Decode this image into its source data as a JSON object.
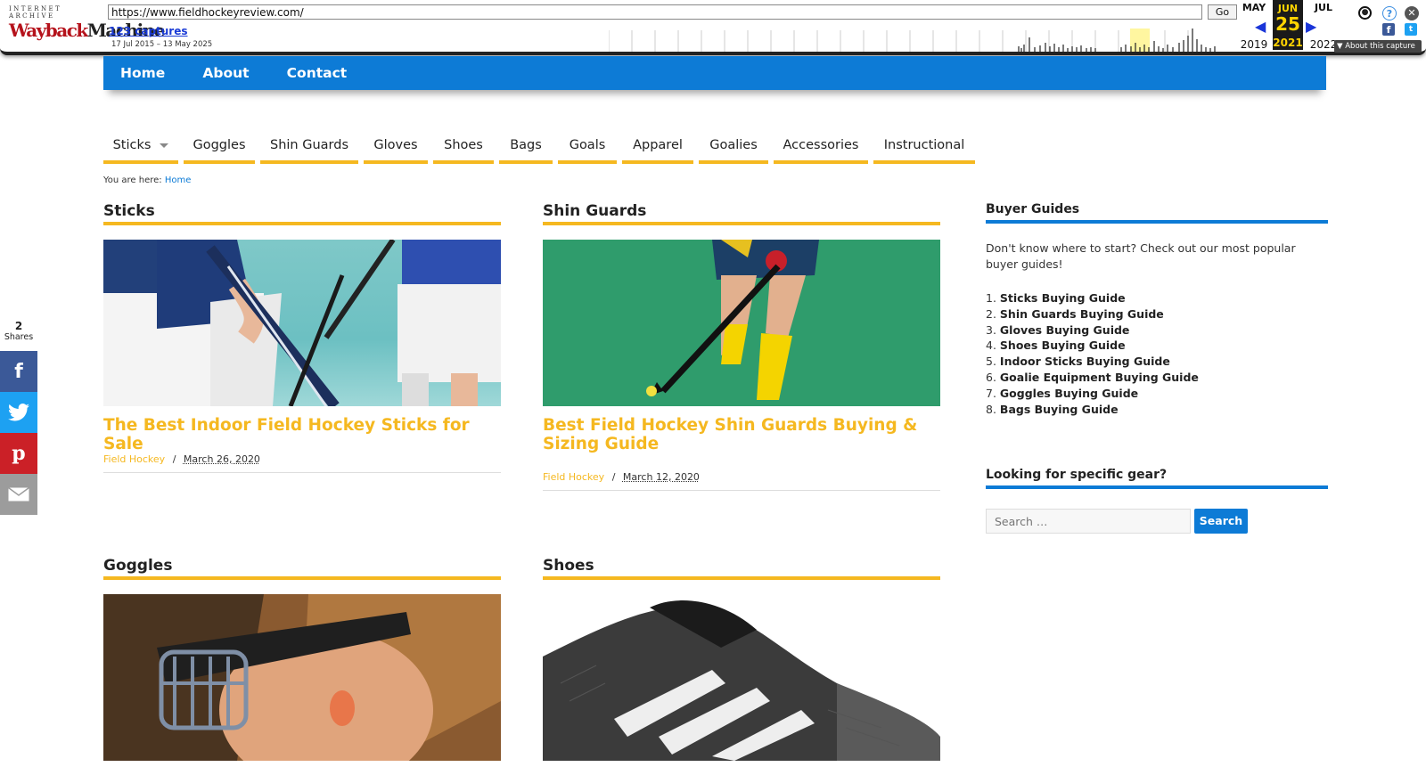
{
  "wayback": {
    "logo_top": "INTERNET ARCHIVE",
    "logo_wayback": "Wayback",
    "logo_machine": "Machine",
    "url": "https://www.fieldhockeyreview.com/",
    "go_label": "Go",
    "captures": "123 captures",
    "range": "17 Jul 2015 – 13 May 2025",
    "prev_month": "MAY",
    "cur_month": "JUN",
    "next_month": "JUL",
    "cur_day": "25",
    "prev_year": "2019",
    "cur_year": "2021",
    "next_year": "2022",
    "about": "▼ About this capture"
  },
  "topnav": [
    "Home",
    "About",
    "Contact"
  ],
  "catnav": {
    "items": [
      "Sticks",
      "Goggles",
      "Shin Guards",
      "Gloves",
      "Shoes",
      "Bags",
      "Goals",
      "Apparel",
      "Goalies",
      "Accessories",
      "Instructional"
    ]
  },
  "breadcrumb": {
    "prefix": "You are here: ",
    "link": "Home"
  },
  "sections": [
    {
      "heading": "Sticks",
      "post_title": "The Best Indoor Field Hockey Sticks for Sale",
      "category": "Field Hockey",
      "date": "March 26, 2020"
    },
    {
      "heading": "Shin Guards",
      "post_title": "Best Field Hockey Shin Guards Buying & Sizing Guide",
      "category": "Field Hockey",
      "date": "March 12, 2020"
    },
    {
      "heading": "Goggles"
    },
    {
      "heading": "Shoes"
    }
  ],
  "meta_sep": "/",
  "sidebar": {
    "guides_title": "Buyer Guides",
    "intro": "Don't know where to start? Check out our most popular buyer guides!",
    "guides": [
      "Sticks Buying Guide",
      "Shin Guards Buying Guide",
      "Gloves Buying Guide",
      "Shoes Buying Guide",
      "Indoor Sticks Buying Guide",
      "Goalie Equipment Buying Guide",
      "Goggles Buying Guide",
      "Bags Buying Guide"
    ],
    "guide_nums": [
      "1.",
      "2.",
      "3.",
      "4.",
      "5.",
      "6.",
      "7.",
      "8."
    ],
    "search_title": "Looking for specific gear?",
    "search_placeholder": "Search …",
    "search_button": "Search"
  },
  "share": {
    "count": "2",
    "label": "Shares"
  },
  "colors": {
    "brand_blue": "#0d7bd6",
    "accent_yellow": "#f5b820",
    "facebook": "#3b5998",
    "twitter": "#1da1f2",
    "pinterest": "#cb2027",
    "email": "#9c9c9c"
  }
}
